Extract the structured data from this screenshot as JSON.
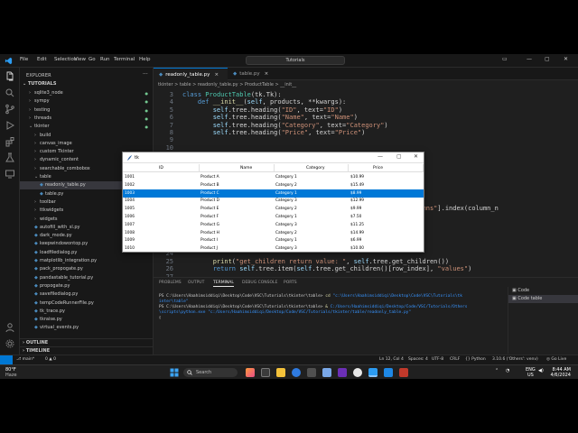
{
  "vscode": {
    "menu": [
      "File",
      "Edit",
      "Selection",
      "View",
      "Go",
      "Run",
      "Terminal",
      "Help"
    ],
    "command_center": "Tutorials",
    "sidebar": {
      "title": "EXPLORER",
      "section": "TUTORIALS",
      "items": [
        {
          "label": "sqlite3_node",
          "type": "folder"
        },
        {
          "label": "sympy",
          "type": "folder"
        },
        {
          "label": "testing",
          "type": "folder"
        },
        {
          "label": "threads",
          "type": "folder"
        },
        {
          "label": "tkinter",
          "type": "folder-open"
        },
        {
          "label": "build",
          "type": "folder"
        },
        {
          "label": "canvas_image",
          "type": "folder"
        },
        {
          "label": "custom Tkinter",
          "type": "folder"
        },
        {
          "label": "dynamic_content",
          "type": "folder"
        },
        {
          "label": "searchable_combobox",
          "type": "folder"
        },
        {
          "label": "table",
          "type": "folder-open"
        },
        {
          "label": "readonly_table.py",
          "type": "file"
        },
        {
          "label": "table.py",
          "type": "file"
        },
        {
          "label": "toolbar",
          "type": "folder"
        },
        {
          "label": "ttkwidgets",
          "type": "folder"
        },
        {
          "label": "widgets",
          "type": "folder"
        },
        {
          "label": "autofill_with_sl.py",
          "type": "file"
        },
        {
          "label": "dark_mode.py",
          "type": "file"
        },
        {
          "label": "keepwindowontop.py",
          "type": "file"
        },
        {
          "label": "loadfiledialog.py",
          "type": "file"
        },
        {
          "label": "matplotlib_integration.py",
          "type": "file"
        },
        {
          "label": "pack_propogate.py",
          "type": "file"
        },
        {
          "label": "pandastable_tutorial.py",
          "type": "file"
        },
        {
          "label": "propogate.py",
          "type": "file"
        },
        {
          "label": "savefiledialog.py",
          "type": "file"
        },
        {
          "label": "tempCodeRunnerFile.py",
          "type": "file"
        },
        {
          "label": "tk_trace.py",
          "type": "file"
        },
        {
          "label": "tkraise.py",
          "type": "file"
        },
        {
          "label": "virtual_events.py",
          "type": "file"
        }
      ],
      "outline": "OUTLINE",
      "timeline": "TIMELINE"
    },
    "tabs": [
      {
        "label": "readonly_table.py",
        "active": true
      },
      {
        "label": "table.py",
        "active": false
      }
    ],
    "breadcrumb": "tkinter > table > readonly_table.py > ProductTable > __init__",
    "code_lines": [
      {
        "n": "3",
        "html": "<span class='kw'>class</span> <span class='cls'>ProductTable</span><span class='pl'>(tk.Tk):</span>"
      },
      {
        "n": "4",
        "html": "    <span class='kw'>def</span> <span class='fn'>__init__</span><span class='pl'>(</span><span class='var'>self</span><span class='pl'>, products, **kwargs):</span>"
      },
      {
        "n": "5",
        "html": "        <span class='var'>self</span><span class='pl'>.tree.heading(</span><span class='str'>\"ID\"</span><span class='pl'>, text=</span><span class='str'>\"ID\"</span><span class='pl'>)</span>"
      },
      {
        "n": "6",
        "html": "        <span class='var'>self</span><span class='pl'>.tree.heading(</span><span class='str'>\"Name\"</span><span class='pl'>, text=</span><span class='str'>\"Name\"</span><span class='pl'>)</span>"
      },
      {
        "n": "7",
        "html": "        <span class='var'>self</span><span class='pl'>.tree.heading(</span><span class='str'>\"Category\"</span><span class='pl'>, text=</span><span class='str'>\"Category\"</span><span class='pl'>)</span>"
      },
      {
        "n": "8",
        "html": "        <span class='var'>self</span><span class='pl'>.tree.heading(</span><span class='str'>\"Price\"</span><span class='pl'>, text=</span><span class='str'>\"Price\"</span><span class='pl'>)</span>"
      },
      {
        "n": "9",
        "html": ""
      },
      {
        "n": "10",
        "html": ""
      },
      {
        "n": "11",
        "html": ""
      },
      {
        "n": "12",
        "html": ""
      },
      {
        "n": "13",
        "html": ""
      },
      {
        "n": "14",
        "html": ""
      },
      {
        "n": "15",
        "html": ""
      },
      {
        "n": "16",
        "html": ""
      },
      {
        "n": "17",
        "html": ""
      },
      {
        "n": "18",
        "html": "                                                   <span class='pl'>f.tree[</span><span class='str'>\"columns\"</span><span class='pl'>].index(column_n</span>"
      },
      {
        "n": "19",
        "html": ""
      },
      {
        "n": "20",
        "html": ""
      },
      {
        "n": "21",
        "html": ""
      },
      {
        "n": "22",
        "html": ""
      },
      {
        "n": "23",
        "html": ""
      },
      {
        "n": "24",
        "html": ""
      },
      {
        "n": "25",
        "html": "        <span class='fn'>print</span><span class='pl'>(</span><span class='str'>\"get_children return value: \"</span><span class='pl'>, </span><span class='var'>self</span><span class='pl'>.tree.get_children())</span>"
      },
      {
        "n": "26",
        "html": "        <span class='kw'>return</span> <span class='var'>self</span><span class='pl'>.tree.item(</span><span class='var'>self</span><span class='pl'>.tree.get_children()[row_index], </span><span class='str'>\"values\"</span><span class='pl'>)</span>"
      },
      {
        "n": "27",
        "html": ""
      }
    ],
    "panel_tabs": [
      "PROBLEMS",
      "OUTPUT",
      "TERMINAL",
      "DEBUG CONSOLE",
      "PORTS"
    ],
    "terminal_lines": [
      "<span class='path'>PS C:\\Users\\Haahimsiddiqi\\Desktop\\Code\\VSC\\Tutorials\\tkinter\\table></span> <span class='cmd'>cd</span> <span class='arg'>\"c:\\Users\\Haahimsiddiqi\\Desktop\\Code\\VSC\\Tutorials\\tk</span>",
      "<span class='arg'>inter\\table\"</span>",
      "<span class='path'>PS C:\\Users\\Haahimsiddiqi\\Desktop\\Code\\VSC\\Tutorials\\tkinter\\table></span> <span class='cmd'>&amp;</span> <span class='arg'>C:/Users/Haahimsiddiqi/Desktop/Code/VSC/Tutorials/Others</span>",
      "<span class='arg'>\\scripts\\python.exe</span> <span class='arg'>\"c:/Users/Haahimsiddiqi/Desktop/Code/VSC/Tutorials/tkinter/table/readonly_table.py\"</span>",
      "<span class='path'>&#9647;</span>"
    ],
    "terminal_list": [
      {
        "label": "Code",
        "selected": false
      },
      {
        "label": "Code table",
        "selected": true
      }
    ],
    "status": {
      "branch": "main*",
      "errors": "0 ▲ 0",
      "cursor": "Ln 12, Col 4",
      "spaces": "Spaces: 4",
      "encoding": "UTF-8",
      "eol": "CRLF",
      "language": "Python",
      "interpreter": "3.10.6 ('Others': venv)",
      "golive": "Go Live"
    }
  },
  "tk_window": {
    "title": "tk",
    "columns": [
      "ID",
      "Name",
      "Category",
      "Price"
    ],
    "rows": [
      [
        "1001",
        "Product A",
        "Category 1",
        "$10.99"
      ],
      [
        "1002",
        "Product B",
        "Category 2",
        "$15.49"
      ],
      [
        "1003",
        "Product C",
        "Category 1",
        "$8.99"
      ],
      [
        "1004",
        "Product D",
        "Category 3",
        "$12.99"
      ],
      [
        "1005",
        "Product E",
        "Category 2",
        "$9.99"
      ],
      [
        "1006",
        "Product F",
        "Category 1",
        "$7.50"
      ],
      [
        "1007",
        "Product G",
        "Category 3",
        "$11.25"
      ],
      [
        "1008",
        "Product H",
        "Category 2",
        "$14.99"
      ],
      [
        "1009",
        "Product I",
        "Category 1",
        "$6.99"
      ],
      [
        "1010",
        "Product J",
        "Category 3",
        "$10.00"
      ]
    ],
    "selected_row": 2
  },
  "taskbar": {
    "temp": "80°F",
    "weather": "Haze",
    "search_placeholder": "Search",
    "lang": "ENG",
    "region": "US",
    "time": "8:44 AM",
    "date": "4/6/2024"
  }
}
